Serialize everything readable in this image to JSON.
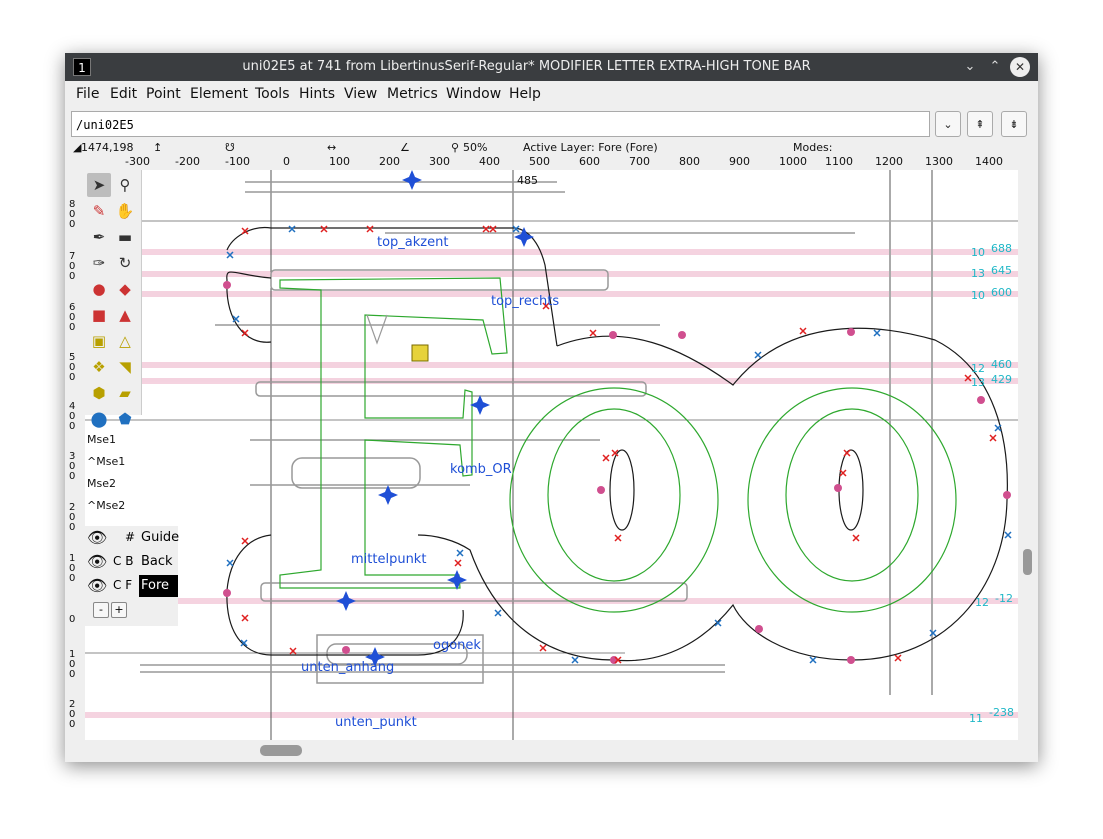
{
  "window": {
    "title": "uni02E5 at 741 from LibertinusSerif-Regular* MODIFIER LETTER EXTRA-HIGH TONE BAR",
    "icon_label": "1",
    "minimize_icon": "chevron-down-icon",
    "maximize_icon": "chevron-up-icon",
    "close_icon": "close-icon"
  },
  "menu": [
    "File",
    "Edit",
    "Point",
    "Element",
    "Tools",
    "Hints",
    "View",
    "Metrics",
    "Window",
    "Help"
  ],
  "toolbar": {
    "glyph_path": "/uni02E5",
    "dropdown_glyph": "⌄",
    "prev_glyph": "⇞",
    "next_glyph": "⇟"
  },
  "info": {
    "coords": "1474,198",
    "zoom": "50%",
    "active_layer": "Active Layer: Fore (Fore)",
    "modes": "Modes:"
  },
  "ruler_ticks": [
    "-300",
    "-200",
    "-100",
    "0",
    "100",
    "200",
    "300",
    "400",
    "500",
    "600",
    "700",
    "800",
    "900",
    "1000",
    "1100",
    "1200",
    "1300",
    "1400"
  ],
  "left_ruler_ticks": [
    {
      "label": "8\n0\n0"
    },
    {
      "label": "7\n0\n0"
    },
    {
      "label": "6\n0\n0"
    },
    {
      "label": "5\n0\n0"
    },
    {
      "label": "4\n0\n0"
    },
    {
      "label": "3\n0\n0"
    },
    {
      "label": "2\n0\n0"
    },
    {
      "label": "1\n0\n0"
    },
    {
      "label": "0"
    },
    {
      "label": "1\n0\n0"
    },
    {
      "label": "2\n0\n0"
    }
  ],
  "tools": {
    "mse1": "Mse1",
    "mse1_ctrl": "^Mse1",
    "mse2": "Mse2",
    "mse2_ctrl": "^Mse2"
  },
  "layers": [
    {
      "flags": "#",
      "name": "Guide",
      "active": false
    },
    {
      "flags": "C B",
      "name": "Back",
      "active": false
    },
    {
      "flags": "C F",
      "name": "Fore",
      "active": true
    }
  ],
  "layer_buttons": {
    "remove": "-",
    "add": "+"
  },
  "anchors": {
    "top_akzent": "top_akzent",
    "top_rechts": "top_rechts",
    "komb_OR": "komb_OR",
    "mittelpunkt": "mittelpunkt",
    "ogonek": "ogonek",
    "unten_anhang": "unten_anhang",
    "unten_punkt": "unten_punkt"
  },
  "advance_width_label": "485",
  "metric_lines": [
    {
      "count": "10",
      "value": "688"
    },
    {
      "count": "13",
      "value": "645"
    },
    {
      "count": "10",
      "value": "600"
    },
    {
      "count": "12",
      "value": "460"
    },
    {
      "count": "13",
      "value": "429"
    },
    {
      "count": "12",
      "value": "-12"
    },
    {
      "count": "11",
      "value": "-238"
    }
  ],
  "colors": {
    "titlebar": "#3a3d40",
    "foreground_outline": "#1a1a1a",
    "background_outline": "#2ea82e",
    "anchor": "#1f4fd6",
    "metric_label": "#1fb7c7",
    "point_corner": "#e02020",
    "point_curve": "#d04f8f",
    "point_tangent": "#2070c0"
  }
}
